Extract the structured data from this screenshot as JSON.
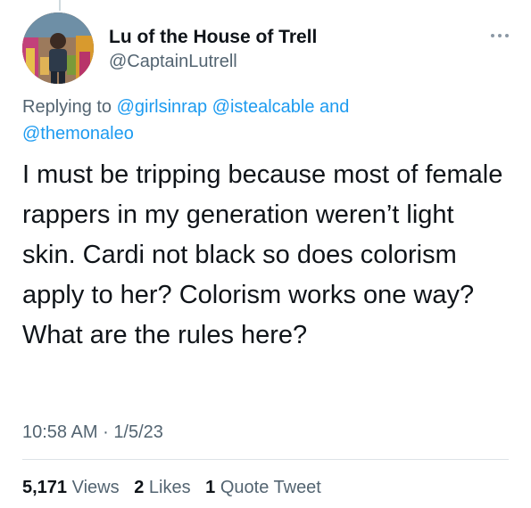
{
  "author": {
    "name": "Lu of the House of Trell",
    "handle": "@CaptainLutrell"
  },
  "icons": {
    "avatar": "profile-photo",
    "more": "more-options-icon"
  },
  "reply": {
    "prefix": "Replying to",
    "mentions": [
      "@girlsinrap",
      "@istealcable",
      "@themonaleo"
    ],
    "joiner": "and"
  },
  "tweet": {
    "text": "I must be tripping because most of female rappers in my generation weren’t light skin. Cardi not black so does colorism apply to her? Colorism works one way? What are the rules here?",
    "time": "10:58 AM",
    "separator": "·",
    "date": "1/5/23"
  },
  "stats": {
    "views": {
      "count": "5,171",
      "label": "Views"
    },
    "likes": {
      "count": "2",
      "label": "Likes"
    },
    "quotes": {
      "count": "1",
      "label": "Quote Tweet"
    }
  },
  "colors": {
    "link": "#1d9bf0",
    "secondary": "#536471",
    "primary": "#0f1419",
    "divider": "#dde3e7"
  }
}
